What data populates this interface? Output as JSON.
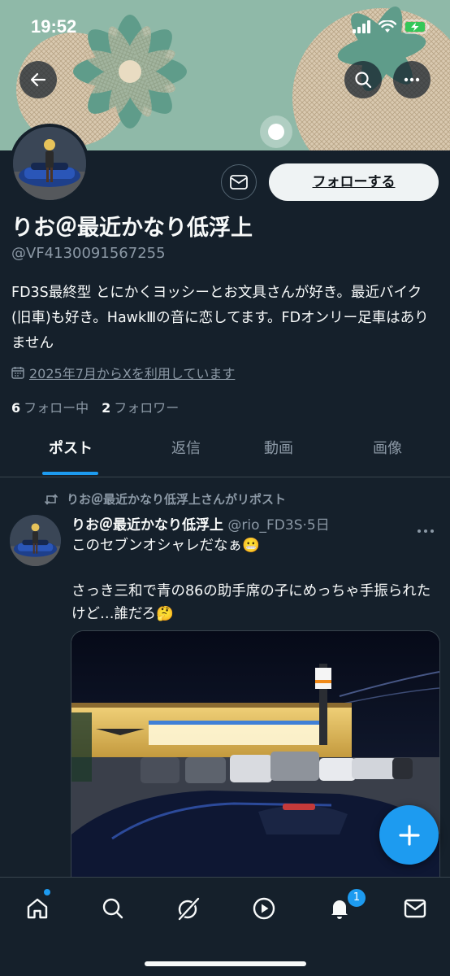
{
  "status_bar": {
    "time": "19:52"
  },
  "profile": {
    "display_name": "りお＠最近かなり低浮上",
    "handle": "@VF4130091567255",
    "bio": "FD3S最終型 とにかくヨッシーとお文具さんが好き。最近バイク(旧車)も好き。HawkⅢの音に恋してます。FDオンリー足車はありません",
    "joined": "2025年7月からXを利用しています",
    "following_count": "6",
    "following_label": "フォロー中",
    "followers_count": "2",
    "followers_label": "フォロワー",
    "follow_button": "フォローする"
  },
  "tabs": [
    {
      "label": "ポスト",
      "active": true
    },
    {
      "label": "返信",
      "active": false
    },
    {
      "label": "動画",
      "active": false
    },
    {
      "label": "画像",
      "active": false
    }
  ],
  "post": {
    "repost_label": "りお＠最近かなり低浮上さんがリポスト",
    "author_name": "りお＠最近かなり低浮上",
    "author_handle": "@rio_FD3S",
    "separator": "·",
    "time": "5日",
    "line1": "このセブンオシャレだなぁ😬",
    "line2": "さっき三和で青の86の助手席の子にめっちゃ手振られたけど…誰だろ🤔"
  },
  "bottom_nav": {
    "notifications_badge": "1"
  },
  "colors": {
    "background": "#15202b",
    "accent": "#1d9bf0",
    "text": "#f7f9f9",
    "muted": "#8b98a5",
    "border": "#38444d"
  }
}
